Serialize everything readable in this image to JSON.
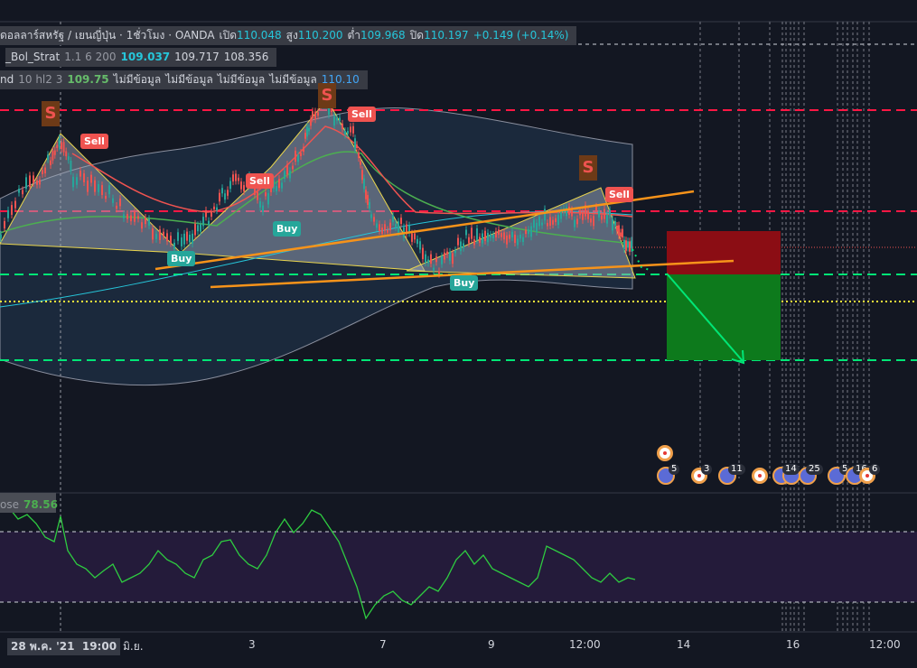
{
  "header": {
    "symbol": "ดอลลาร์สหรัฐ / เยนญี่ปุ่น · 1ชั่วโมง · OANDA",
    "open_label": "เปิด",
    "open": "110.048",
    "high_label": "สูง",
    "high": "110.200",
    "low_label": "ต่ำ",
    "low": "109.968",
    "close_label": "ปิด",
    "close": "110.197",
    "change": "+0.149 (+0.14%)"
  },
  "indicator1": {
    "name": "_Bol_Strat",
    "params": "1.1 6 200",
    "v1": "109.037",
    "v2": "109.717",
    "v3": "108.356"
  },
  "indicator2": {
    "name": "nd",
    "params": "10 hl2 3",
    "v1": "109.75",
    "na1": "ไม่มีข้อมูล",
    "na2": "ไม่มีข้อมูล",
    "na3": "ไม่มีข้อมูล",
    "na4": "ไม่มีข้อมูล",
    "v2": "110.10"
  },
  "signals": {
    "sell": "Sell",
    "buy": "Buy",
    "s": "S"
  },
  "oscillator": {
    "name": "ose",
    "value": "78.56"
  },
  "time_axis": {
    "t1": "28 พ.ค. '21",
    "t1b": "19:00",
    "t2": "มิ.ย.",
    "t3": "3",
    "t4": "7",
    "t5": "9",
    "t6": "12:00",
    "t7": "14",
    "t8": "16",
    "t9": "12:00"
  },
  "events": {
    "c1": "5",
    "c2": "3",
    "c3": "11",
    "c4": "14",
    "c5": "25",
    "c6": "5",
    "c7": "16",
    "c8": "6"
  },
  "colors": {
    "background": "#131722",
    "sell": "#ef5350",
    "buy": "#26a69a",
    "trend": "#f7931a",
    "green_line": "#00e676",
    "red_line": "#ff1744",
    "osc_line": "#2ecc40",
    "osc_bg": "#241b3a"
  }
}
